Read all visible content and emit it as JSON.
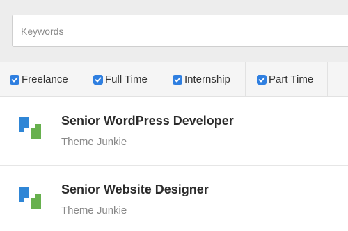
{
  "search": {
    "placeholder": "Keywords",
    "value": ""
  },
  "filters": [
    {
      "label": "Freelance",
      "checked": true
    },
    {
      "label": "Full Time",
      "checked": true
    },
    {
      "label": "Internship",
      "checked": true
    },
    {
      "label": "Part Time",
      "checked": true
    }
  ],
  "jobs": [
    {
      "title": "Senior WordPress Developer",
      "company": "Theme Junkie",
      "logo_icon": "theme-junkie-logo"
    },
    {
      "title": "Senior Website Designer",
      "company": "Theme Junkie",
      "logo_icon": "theme-junkie-logo"
    }
  ],
  "colors": {
    "checkbox": "#2f7fe0",
    "logo_blue": "#2f86d6",
    "logo_green": "#67b04e"
  }
}
